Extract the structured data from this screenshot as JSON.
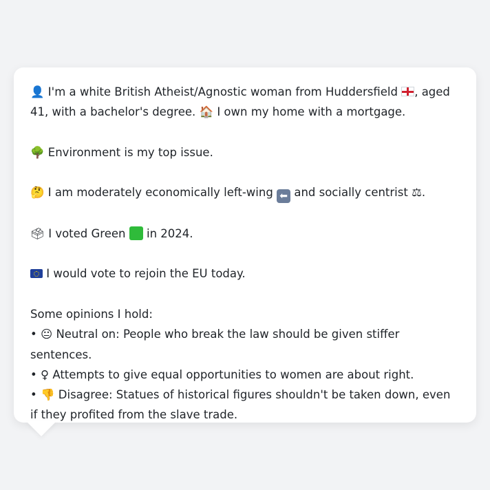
{
  "profile": {
    "line1_icon": "👤",
    "line1_a": "I'm a white British Atheist/Agnostic woman from Huddersfield",
    "line1_b": ", aged 41, with a bachelor's degree.",
    "line1_home_icon": "🏠",
    "line1_c": "I own my home with a mortgage.",
    "issue_icon": "🌳",
    "issue_text": "Environment is my top issue.",
    "econ_icon": "🤔",
    "econ_a": "I am moderately economically left-wing",
    "econ_b": "and socially centrist",
    "econ_c": ".",
    "vote_icon": "🗳",
    "vote_a": "I voted Green",
    "vote_b": "in 2024.",
    "eu_text": "I would vote to rejoin the EU today.",
    "opinions_heading": "Some opinions I hold:",
    "opinions": [
      {
        "bullet": "•",
        "icon": "😐",
        "text": "Neutral on: People who break the law should be given stiffer sentences."
      },
      {
        "bullet": "•",
        "icon": "♀",
        "text": "Attempts to give equal opportunities to women are about right."
      },
      {
        "bullet": "•",
        "icon": "👎",
        "text": "Disagree: Statues of historical figures shouldn't be taken down, even if they profited from the slave trade."
      }
    ]
  },
  "icons": {
    "left_arrow": "⬅",
    "scales": "⚖"
  },
  "colors": {
    "background": "#f2f3f5",
    "bubble": "#ffffff",
    "text": "#1f2328"
  }
}
